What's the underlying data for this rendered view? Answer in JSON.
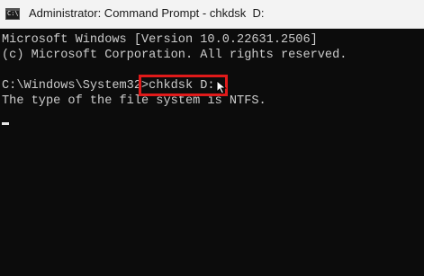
{
  "window": {
    "title": "Administrator: Command Prompt - chkdsk  D:",
    "app_icon": "console-icon"
  },
  "console": {
    "line1": "Microsoft Windows [Version 10.0.22631.2506]",
    "line2": "(c) Microsoft Corporation. All rights reserved.",
    "prompt": "C:\\Windows\\System32>",
    "command": "chkdsk D:",
    "output": "The type of the file system is NTFS."
  },
  "colors": {
    "background": "#0c0c0c",
    "text": "#cccccc",
    "highlight": "#e01a1a"
  }
}
